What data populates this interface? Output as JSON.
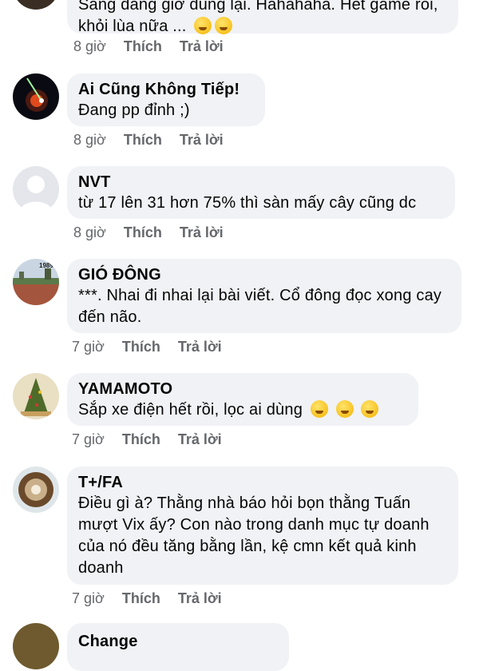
{
  "comments": [
    {
      "name": "",
      "text": "Sáng đang giờ đúng lại. Hahahaha. Hết game rồi, khỏi lùa nữa ...",
      "time": "8 giờ",
      "like": "Thích",
      "reply": "Trả lời",
      "emoji": "rolling-laugh-emoji"
    },
    {
      "name": "Ai Cũng Không Tiếp!",
      "text": "Đang pp đỉnh ;)",
      "time": "8 giờ",
      "like": "Thích",
      "reply": "Trả lời"
    },
    {
      "name": "NVT",
      "text": "từ 17 lên 31 hơn 75% thì sàn mấy cây cũng dc",
      "time": "8 giờ",
      "like": "Thích",
      "reply": "Trả lời"
    },
    {
      "name": "GIÓ ĐÔNG",
      "text": "***. Nhai đi nhai lại bài viết. Cổ đông đọc xong cay đến não.",
      "time": "7 giờ",
      "like": "Thích",
      "reply": "Trả lời",
      "avatar_caption": "1989"
    },
    {
      "name": "YAMAMOTO",
      "text": "Sắp xe điện hết rồi, lọc ai dùng",
      "time": "7 giờ",
      "like": "Thích",
      "reply": "Trả lời",
      "emoji": "hugging-face-emoji"
    },
    {
      "name": "T+/FA",
      "text": "Điều gì à? Thằng nhà báo hỏi bọn thằng Tuấn mượt Vix ấy? Con nào trong danh mục tự doanh của nó đều tăng bằng lần, kệ cmn kết quả kinh doanh",
      "time": "7 giờ",
      "like": "Thích",
      "reply": "Trả lời"
    },
    {
      "name": "Change",
      "text": "",
      "time": "",
      "like": "",
      "reply": ""
    }
  ],
  "colors": {
    "bubble": "#f0f2f5",
    "meta_text": "#65676b",
    "name_text": "#050505"
  }
}
